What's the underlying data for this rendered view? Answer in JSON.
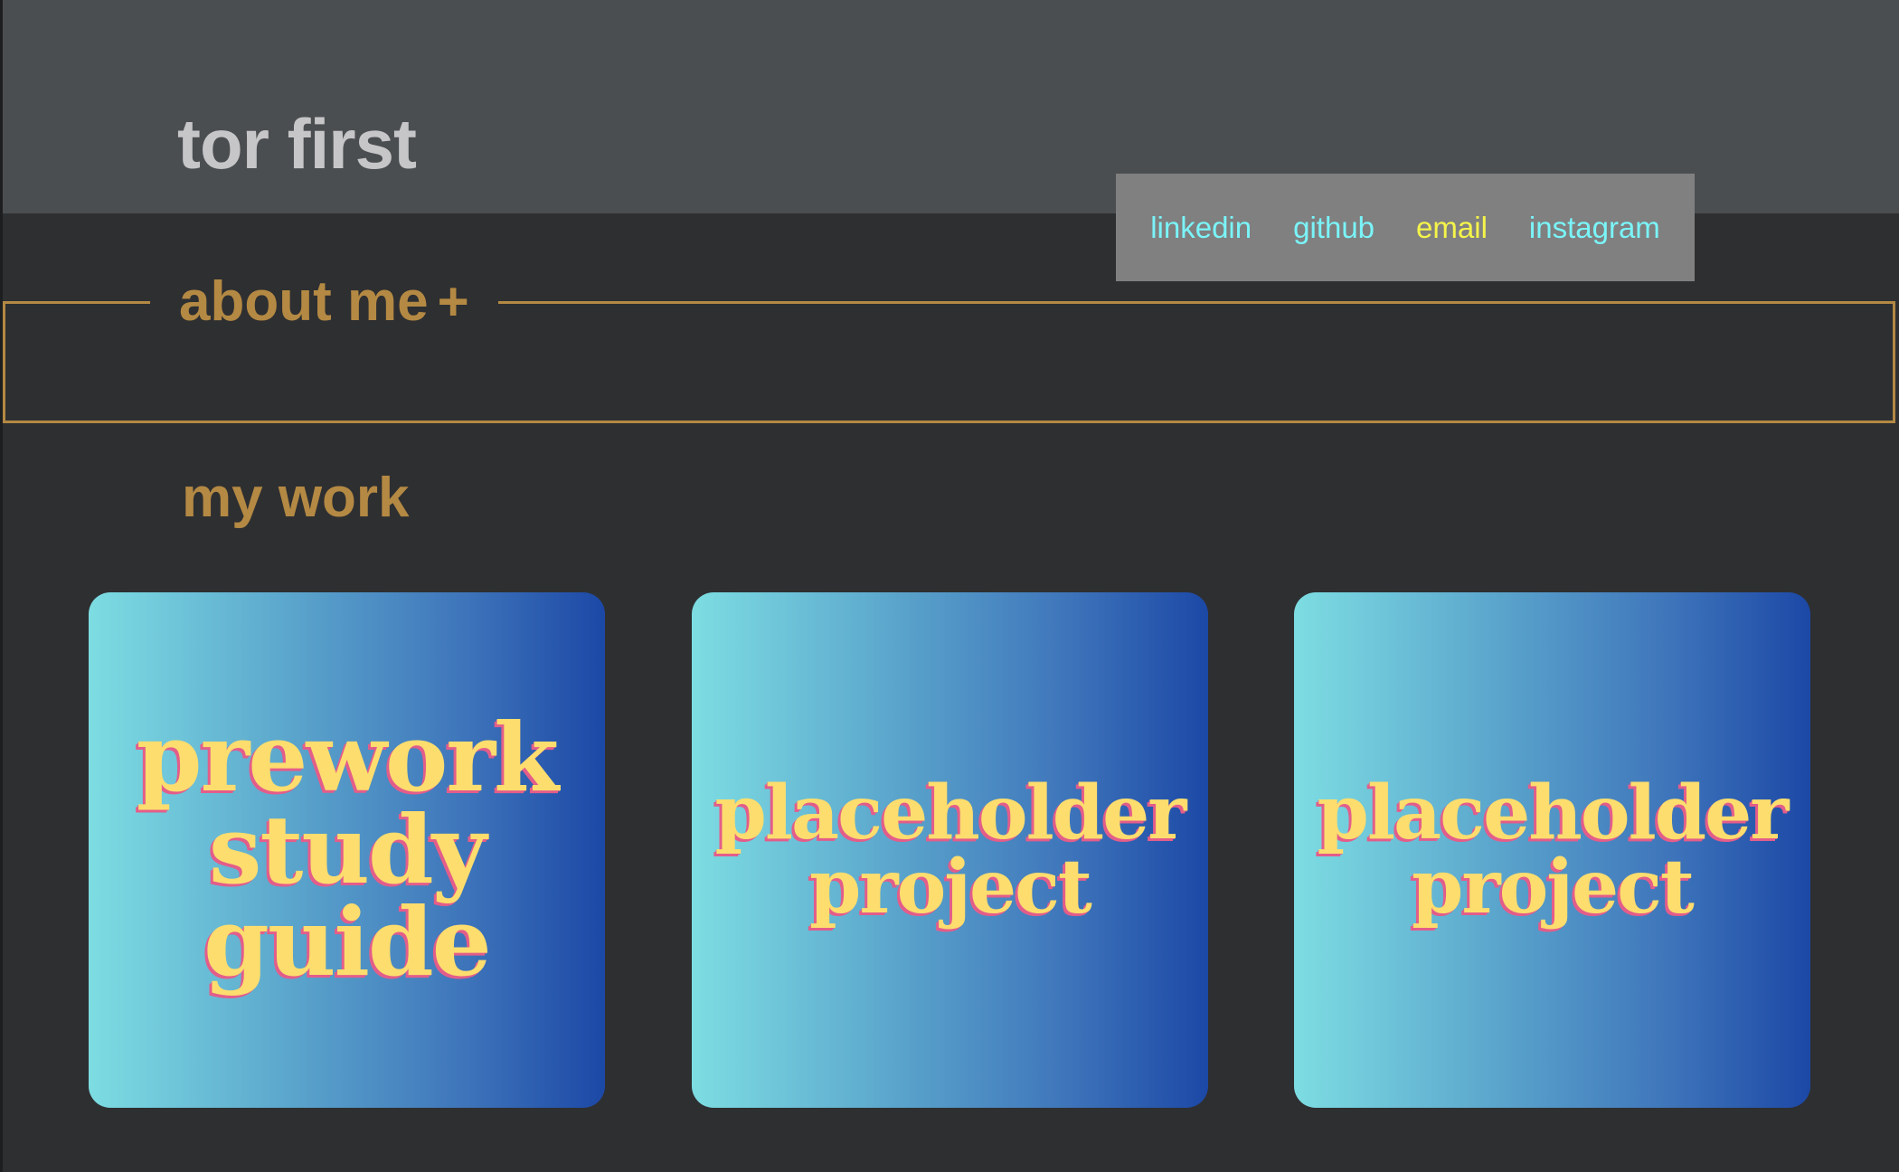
{
  "header": {
    "site_title": "tor first",
    "nav": [
      {
        "label": "linkedin",
        "color": "#7af4f8"
      },
      {
        "label": "github",
        "color": "#7af4f8"
      },
      {
        "label": "email",
        "color": "#f4f44a"
      },
      {
        "label": "instagram",
        "color": "#7af4f8"
      }
    ]
  },
  "about": {
    "label": "about me",
    "toggle": "+"
  },
  "work": {
    "title": "my work",
    "cards": [
      {
        "title": "prework study guide"
      },
      {
        "title": "placeholder project"
      },
      {
        "title": "placeholder project"
      }
    ]
  },
  "colors": {
    "header_bg": "#4b4e50",
    "page_bg": "#2e2f31",
    "accent": "#b48943",
    "card_text": "#fcdd6e",
    "card_text_shadow": "#e35d8a",
    "card_gradient_start": "#7ddde2",
    "card_gradient_end": "#1c48a6"
  }
}
